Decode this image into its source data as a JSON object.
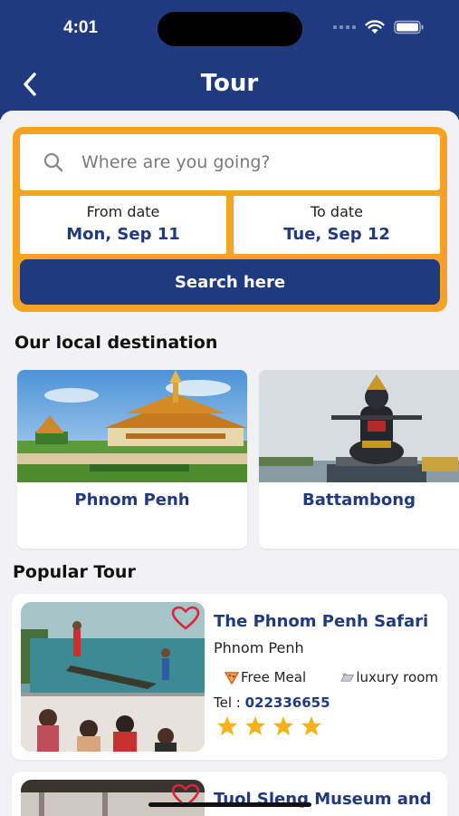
{
  "status": {
    "time": "4:01"
  },
  "nav": {
    "title": "Tour"
  },
  "search": {
    "placeholder": "Where are you going?"
  },
  "dates": {
    "from_label": "From date",
    "from_value": "Mon, Sep 11",
    "to_label": "To date",
    "to_value": "Tue, Sep 12"
  },
  "search_button": "Search here",
  "local_section": "Our local destination",
  "destinations": [
    {
      "name": "Phnom Penh"
    },
    {
      "name": "Battambong"
    }
  ],
  "popular_section": "Popular Tour",
  "tours": [
    {
      "title": "The Phnom Penh Safari",
      "city": "Phnom Penh",
      "amenity1": "Free Meal",
      "amenity2": "luxury room",
      "tel_label": "Tel : ",
      "tel": "022336655",
      "rating": 4
    },
    {
      "title": "Tuol Sleng Museum and"
    }
  ],
  "colors": {
    "primary": "#1f3a7e",
    "accent": "#f6a323",
    "star": "#f5b21b",
    "heart": "#d7263d"
  }
}
